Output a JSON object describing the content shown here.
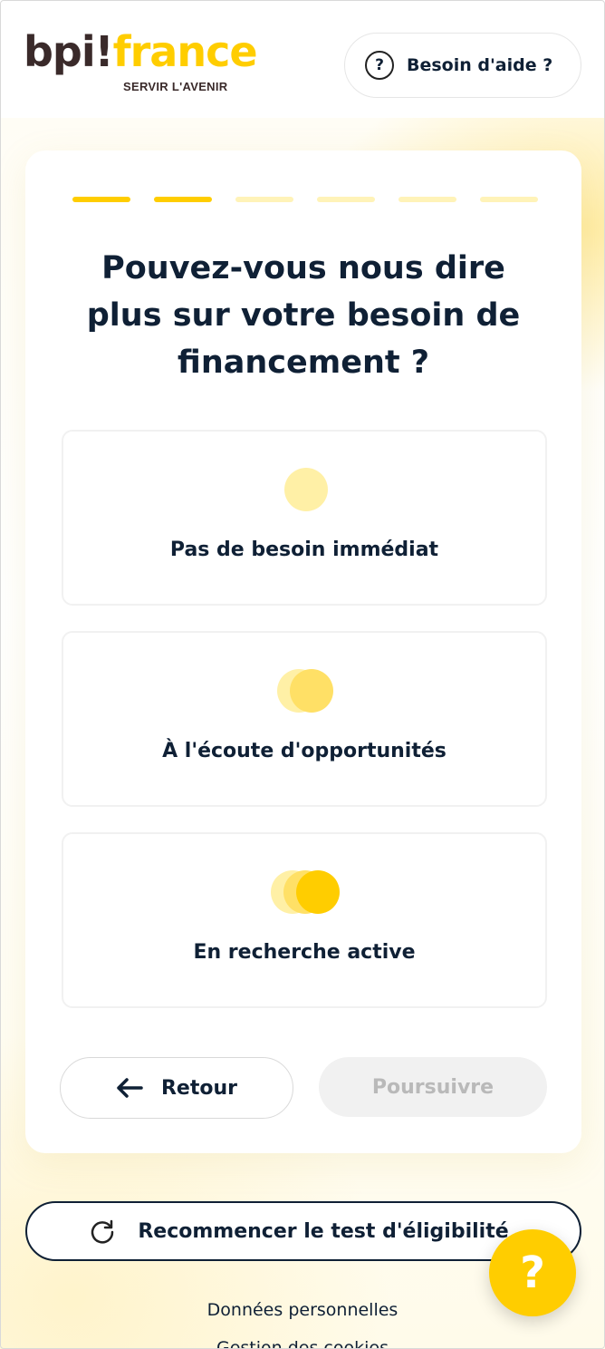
{
  "header": {
    "logo": {
      "bpi": "bpi",
      "excl": "!",
      "france": "france",
      "tagline": "SERVIR L'AVENIR"
    },
    "help_button": {
      "label": "Besoin d'aide ?",
      "icon": "question-circle-icon"
    }
  },
  "progress": {
    "current_step": 2,
    "total_steps": 6,
    "active_color": "#ffcd00",
    "inactive_color": "#fff3b8"
  },
  "question": "Pouvez-vous nous dire plus sur votre besoin de financement ?",
  "options": [
    {
      "label": "Pas de besoin immédiat",
      "icon": "one-dot-icon"
    },
    {
      "label": "À l'écoute d'opportunités",
      "icon": "two-dots-icon"
    },
    {
      "label": "En recherche active",
      "icon": "three-dots-icon"
    }
  ],
  "nav": {
    "back_label": "Retour",
    "next_label": "Poursuivre",
    "next_disabled": true
  },
  "restart": {
    "label": "Recommencer le test d'éligibilité",
    "icon": "refresh-icon"
  },
  "footer": {
    "personal_data": "Données personnelles",
    "next_link_partial": "Gestion des cookies"
  },
  "fab": {
    "label": "?",
    "icon": "help-icon"
  },
  "colors": {
    "brand_yellow": "#ffcd00",
    "text_dark": "#0f2035",
    "logo_brown": "#3a2a2a"
  }
}
